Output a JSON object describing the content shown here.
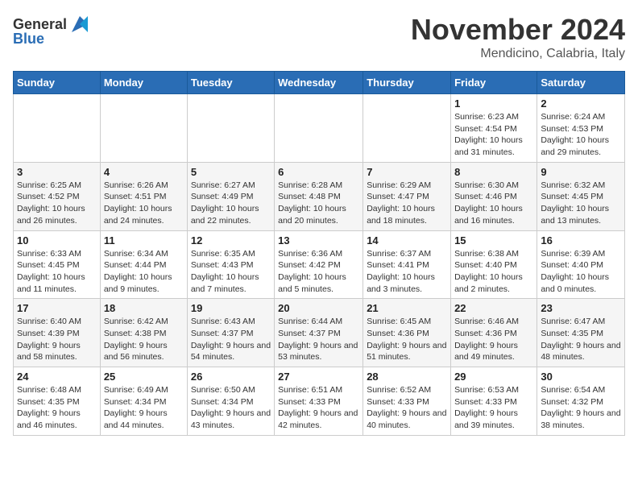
{
  "logo": {
    "text_general": "General",
    "text_blue": "Blue"
  },
  "title": {
    "month_year": "November 2024",
    "location": "Mendicino, Calabria, Italy"
  },
  "weekdays": [
    "Sunday",
    "Monday",
    "Tuesday",
    "Wednesday",
    "Thursday",
    "Friday",
    "Saturday"
  ],
  "weeks": [
    [
      {
        "day": "",
        "info": ""
      },
      {
        "day": "",
        "info": ""
      },
      {
        "day": "",
        "info": ""
      },
      {
        "day": "",
        "info": ""
      },
      {
        "day": "",
        "info": ""
      },
      {
        "day": "1",
        "info": "Sunrise: 6:23 AM\nSunset: 4:54 PM\nDaylight: 10 hours and 31 minutes."
      },
      {
        "day": "2",
        "info": "Sunrise: 6:24 AM\nSunset: 4:53 PM\nDaylight: 10 hours and 29 minutes."
      }
    ],
    [
      {
        "day": "3",
        "info": "Sunrise: 6:25 AM\nSunset: 4:52 PM\nDaylight: 10 hours and 26 minutes."
      },
      {
        "day": "4",
        "info": "Sunrise: 6:26 AM\nSunset: 4:51 PM\nDaylight: 10 hours and 24 minutes."
      },
      {
        "day": "5",
        "info": "Sunrise: 6:27 AM\nSunset: 4:49 PM\nDaylight: 10 hours and 22 minutes."
      },
      {
        "day": "6",
        "info": "Sunrise: 6:28 AM\nSunset: 4:48 PM\nDaylight: 10 hours and 20 minutes."
      },
      {
        "day": "7",
        "info": "Sunrise: 6:29 AM\nSunset: 4:47 PM\nDaylight: 10 hours and 18 minutes."
      },
      {
        "day": "8",
        "info": "Sunrise: 6:30 AM\nSunset: 4:46 PM\nDaylight: 10 hours and 16 minutes."
      },
      {
        "day": "9",
        "info": "Sunrise: 6:32 AM\nSunset: 4:45 PM\nDaylight: 10 hours and 13 minutes."
      }
    ],
    [
      {
        "day": "10",
        "info": "Sunrise: 6:33 AM\nSunset: 4:45 PM\nDaylight: 10 hours and 11 minutes."
      },
      {
        "day": "11",
        "info": "Sunrise: 6:34 AM\nSunset: 4:44 PM\nDaylight: 10 hours and 9 minutes."
      },
      {
        "day": "12",
        "info": "Sunrise: 6:35 AM\nSunset: 4:43 PM\nDaylight: 10 hours and 7 minutes."
      },
      {
        "day": "13",
        "info": "Sunrise: 6:36 AM\nSunset: 4:42 PM\nDaylight: 10 hours and 5 minutes."
      },
      {
        "day": "14",
        "info": "Sunrise: 6:37 AM\nSunset: 4:41 PM\nDaylight: 10 hours and 3 minutes."
      },
      {
        "day": "15",
        "info": "Sunrise: 6:38 AM\nSunset: 4:40 PM\nDaylight: 10 hours and 2 minutes."
      },
      {
        "day": "16",
        "info": "Sunrise: 6:39 AM\nSunset: 4:40 PM\nDaylight: 10 hours and 0 minutes."
      }
    ],
    [
      {
        "day": "17",
        "info": "Sunrise: 6:40 AM\nSunset: 4:39 PM\nDaylight: 9 hours and 58 minutes."
      },
      {
        "day": "18",
        "info": "Sunrise: 6:42 AM\nSunset: 4:38 PM\nDaylight: 9 hours and 56 minutes."
      },
      {
        "day": "19",
        "info": "Sunrise: 6:43 AM\nSunset: 4:37 PM\nDaylight: 9 hours and 54 minutes."
      },
      {
        "day": "20",
        "info": "Sunrise: 6:44 AM\nSunset: 4:37 PM\nDaylight: 9 hours and 53 minutes."
      },
      {
        "day": "21",
        "info": "Sunrise: 6:45 AM\nSunset: 4:36 PM\nDaylight: 9 hours and 51 minutes."
      },
      {
        "day": "22",
        "info": "Sunrise: 6:46 AM\nSunset: 4:36 PM\nDaylight: 9 hours and 49 minutes."
      },
      {
        "day": "23",
        "info": "Sunrise: 6:47 AM\nSunset: 4:35 PM\nDaylight: 9 hours and 48 minutes."
      }
    ],
    [
      {
        "day": "24",
        "info": "Sunrise: 6:48 AM\nSunset: 4:35 PM\nDaylight: 9 hours and 46 minutes."
      },
      {
        "day": "25",
        "info": "Sunrise: 6:49 AM\nSunset: 4:34 PM\nDaylight: 9 hours and 44 minutes."
      },
      {
        "day": "26",
        "info": "Sunrise: 6:50 AM\nSunset: 4:34 PM\nDaylight: 9 hours and 43 minutes."
      },
      {
        "day": "27",
        "info": "Sunrise: 6:51 AM\nSunset: 4:33 PM\nDaylight: 9 hours and 42 minutes."
      },
      {
        "day": "28",
        "info": "Sunrise: 6:52 AM\nSunset: 4:33 PM\nDaylight: 9 hours and 40 minutes."
      },
      {
        "day": "29",
        "info": "Sunrise: 6:53 AM\nSunset: 4:33 PM\nDaylight: 9 hours and 39 minutes."
      },
      {
        "day": "30",
        "info": "Sunrise: 6:54 AM\nSunset: 4:32 PM\nDaylight: 9 hours and 38 minutes."
      }
    ]
  ]
}
